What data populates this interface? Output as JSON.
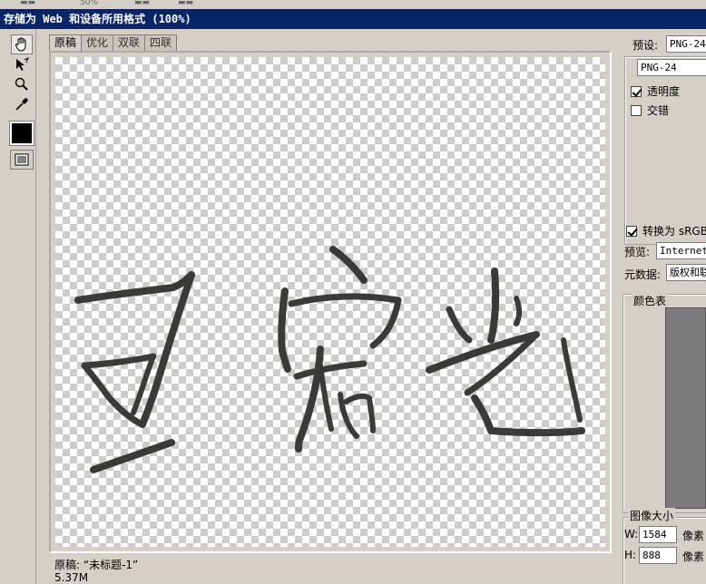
{
  "window": {
    "title": "存储为 Web 和设备所用格式 (100%)"
  },
  "top_strip": {
    "zoom_partial": "50%"
  },
  "tabs": [
    {
      "label": "原稿",
      "active": true
    },
    {
      "label": "优化",
      "active": false
    },
    {
      "label": "双联",
      "active": false
    },
    {
      "label": "四联",
      "active": false
    }
  ],
  "status": {
    "line1": "原稿: “未标题-1”",
    "line2": "5.37M"
  },
  "right_panel": {
    "preset_label": "预设:",
    "preset_value": "PNG-24",
    "format_value": "PNG-24",
    "transparency_label": "透明度",
    "transparency_checked": true,
    "interlaced_label": "交错",
    "interlaced_checked": false,
    "convert_srgb_label": "转换为 sRGB",
    "convert_srgb_checked": true,
    "preview_label": "预览:",
    "preview_value": "Internet",
    "metadata_label": "元数据:",
    "metadata_value": "版权和联",
    "color_table_label": "颜色表",
    "image_size_label": "图像大小",
    "width_label": "W:",
    "width_value": "1584",
    "height_label": "H:",
    "height_value": "888",
    "unit_label": "像素"
  },
  "colors": {
    "titlebar": "#0a246a",
    "ink": "#3b3a36",
    "panel_bg": "#d4d0c8",
    "color_table_preview": "#7c7b7e"
  },
  "icons": [
    "hand-icon",
    "slice-select-icon",
    "zoom-icon",
    "eyedropper-icon",
    "eyedropper-color-swatch",
    "toggle-slices-icon"
  ]
}
